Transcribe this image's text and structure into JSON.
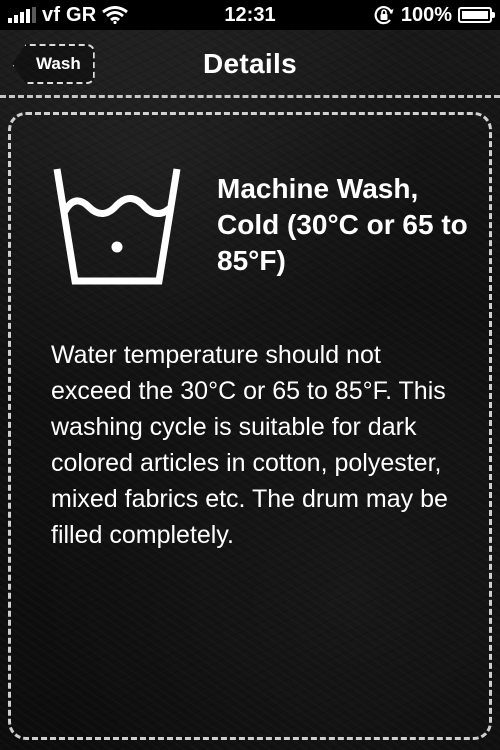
{
  "status_bar": {
    "carrier": "vf GR",
    "time": "12:31",
    "battery": "100%",
    "battery_level": 1.0
  },
  "nav": {
    "back_label": "Wash",
    "title": "Details"
  },
  "detail": {
    "icon": "machine-wash-cold-icon",
    "title": "Machine Wash, Cold (30°C or 65 to 85°F)",
    "description": "Water temperature should not exceed the 30°C or 65 to 85°F. This washing cycle is suitable for dark colored articles in cotton, polyester, mixed fabrics etc. The drum may be filled completely."
  }
}
